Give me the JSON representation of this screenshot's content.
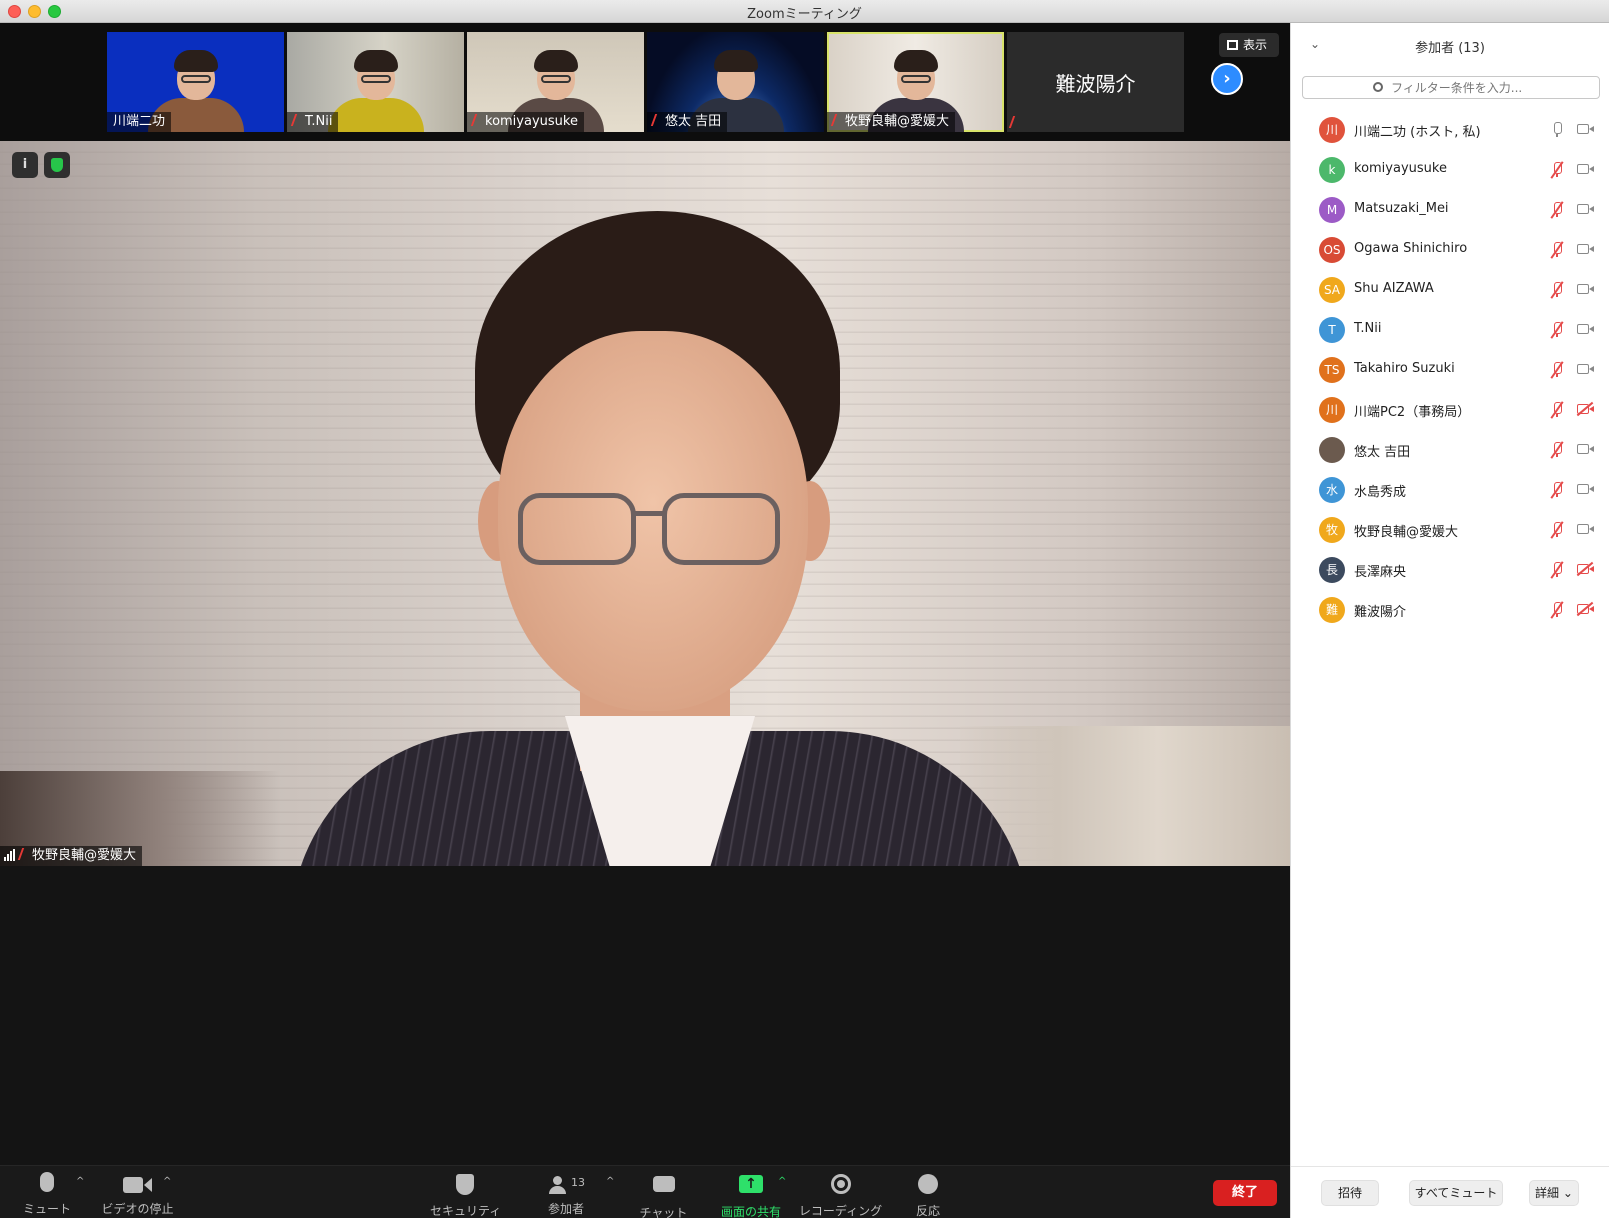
{
  "window": {
    "title": "Zoomミーティング"
  },
  "strip": {
    "thumbs": [
      {
        "name": "川端二功",
        "muted": false
      },
      {
        "name": "T.Nii",
        "muted": true
      },
      {
        "name": "komiyayusuke",
        "muted": true
      },
      {
        "name": "悠太 吉田",
        "muted": true
      },
      {
        "name": "牧野良輔@愛媛大",
        "muted": true,
        "active": true
      },
      {
        "name": "難波陽介",
        "muted": true,
        "video_off": true
      }
    ],
    "next_icon": "chevron-right-icon",
    "view_label": "表示"
  },
  "main_video": {
    "speaker_name": "牧野良輔@愛媛大"
  },
  "toolbar": {
    "mute": "ミュート",
    "video": "ビデオの停止",
    "security": "セキュリティ",
    "participants": "参加者",
    "participants_count": "13",
    "chat": "チャット",
    "share": "画面の共有",
    "record": "レコーディング",
    "reaction": "反応",
    "end": "終了",
    "share_color": "#2ee06a",
    "end_color": "#d92020"
  },
  "panel": {
    "title": "参加者 (13)",
    "search_placeholder": "フィルター条件を入力...",
    "participants": [
      {
        "initials": "川",
        "name": "川端二功 (ホスト, 私)",
        "color": "#e0533c",
        "mic": "on",
        "video": "on"
      },
      {
        "initials": "k",
        "name": "komiyayusuke",
        "color": "#4cb86b",
        "mic": "muted",
        "video": "on"
      },
      {
        "initials": "M",
        "name": "Matsuzaki_Mei",
        "color": "#9c5bc6",
        "mic": "muted",
        "video": "on"
      },
      {
        "initials": "OS",
        "name": "Ogawa Shinichiro",
        "color": "#d84b35",
        "mic": "muted",
        "video": "on"
      },
      {
        "initials": "SA",
        "name": "Shu AIZAWA",
        "color": "#f0a81c",
        "mic": "muted",
        "video": "on"
      },
      {
        "initials": "T",
        "name": "T.Nii",
        "color": "#3f95d6",
        "mic": "muted",
        "video": "on"
      },
      {
        "initials": "TS",
        "name": "Takahiro Suzuki",
        "color": "#e0711c",
        "mic": "muted",
        "video": "on"
      },
      {
        "initials": "川",
        "name": "川端PC2（事務局）",
        "color": "#e0711c",
        "mic": "muted",
        "video": "off"
      },
      {
        "initials": "",
        "name": "悠太 吉田",
        "color": "#6b5a4e",
        "mic": "muted",
        "video": "on"
      },
      {
        "initials": "水",
        "name": "水島秀成",
        "color": "#3f95d6",
        "mic": "muted",
        "video": "on"
      },
      {
        "initials": "牧",
        "name": "牧野良輔@愛媛大",
        "color": "#f0a81c",
        "mic": "muted",
        "video": "on"
      },
      {
        "initials": "長",
        "name": "長澤麻央",
        "color": "#3c4a5e",
        "mic": "muted",
        "video": "off"
      },
      {
        "initials": "難",
        "name": "難波陽介",
        "color": "#f0a81c",
        "mic": "muted",
        "video": "off"
      }
    ],
    "invite": "招待",
    "mute_all": "すべてミュート",
    "more": "詳細"
  }
}
